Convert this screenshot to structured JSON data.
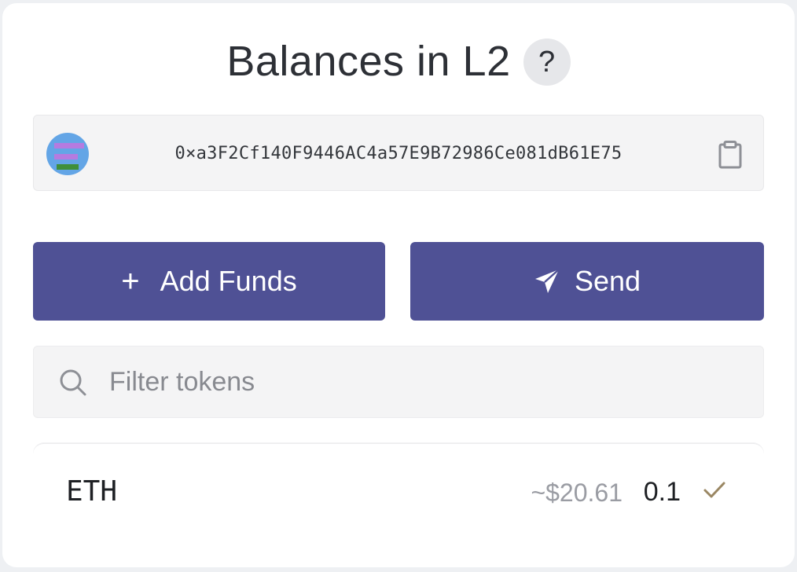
{
  "header": {
    "title": "Balances in L2",
    "help_icon": "?"
  },
  "account": {
    "address": "0×a3F2Cf140F9446AC4a57E9B72986Ce081dB61E75",
    "avatar_icon": "identicon-avatar",
    "copy_icon": "clipboard-icon"
  },
  "actions": {
    "add_funds_icon": "+",
    "add_funds_label": "Add Funds",
    "send_label": "Send",
    "send_icon": "paper-plane-icon"
  },
  "search": {
    "placeholder": "Filter tokens",
    "value": ""
  },
  "tokens": [
    {
      "symbol": "ETH",
      "usd_value": "~$20.61",
      "amount": "0.1",
      "verified_icon": "check-icon"
    }
  ],
  "colors": {
    "primary_button": "#4f5195",
    "check": "#9a8763",
    "muted_text": "#9a9ca3"
  }
}
